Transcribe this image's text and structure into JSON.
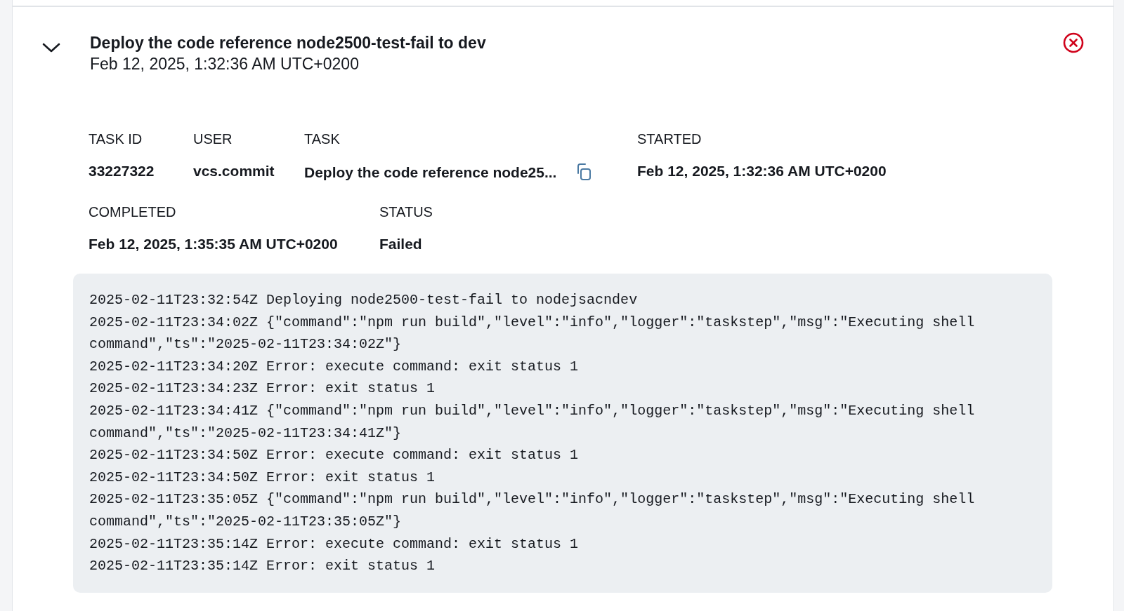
{
  "task": {
    "title": "Deploy the code reference node2500-test-fail to dev",
    "subtitle": "Feb 12, 2025, 1:32:36 AM UTC+0200",
    "expanded": true
  },
  "fields": [
    [
      {
        "label": "TASK ID",
        "value": "33227322",
        "copyable": false
      },
      {
        "label": "USER",
        "value": "vcs.commit",
        "copyable": false
      },
      {
        "label": "TASK",
        "value": "Deploy the code reference node25...",
        "copyable": true
      },
      {
        "label": "STARTED",
        "value": "Feb 12, 2025, 1:32:36 AM UTC+0200",
        "copyable": false
      }
    ],
    [
      {
        "label": "COMPLETED",
        "value": "Feb 12, 2025, 1:35:35 AM UTC+0200",
        "copyable": false
      },
      {
        "label": "STATUS",
        "value": "Failed",
        "copyable": false
      }
    ]
  ],
  "log": [
    "2025-02-11T23:32:54Z Deploying node2500-test-fail to nodejsacndev",
    "2025-02-11T23:34:02Z {\"command\":\"npm run build\",\"level\":\"info\",\"logger\":\"taskstep\",\"msg\":\"Executing shell command\",\"ts\":\"2025-02-11T23:34:02Z\"}",
    "2025-02-11T23:34:20Z Error: execute command: exit status 1",
    "2025-02-11T23:34:23Z Error: exit status 1",
    "2025-02-11T23:34:41Z {\"command\":\"npm run build\",\"level\":\"info\",\"logger\":\"taskstep\",\"msg\":\"Executing shell command\",\"ts\":\"2025-02-11T23:34:41Z\"}",
    "2025-02-11T23:34:50Z Error: execute command: exit status 1",
    "2025-02-11T23:34:50Z Error: exit status 1",
    "2025-02-11T23:35:05Z {\"command\":\"npm run build\",\"level\":\"info\",\"logger\":\"taskstep\",\"msg\":\"Executing shell command\",\"ts\":\"2025-02-11T23:35:05Z\"}",
    "2025-02-11T23:35:14Z Error: execute command: exit status 1",
    "2025-02-11T23:35:14Z Error: exit status 1"
  ]
}
